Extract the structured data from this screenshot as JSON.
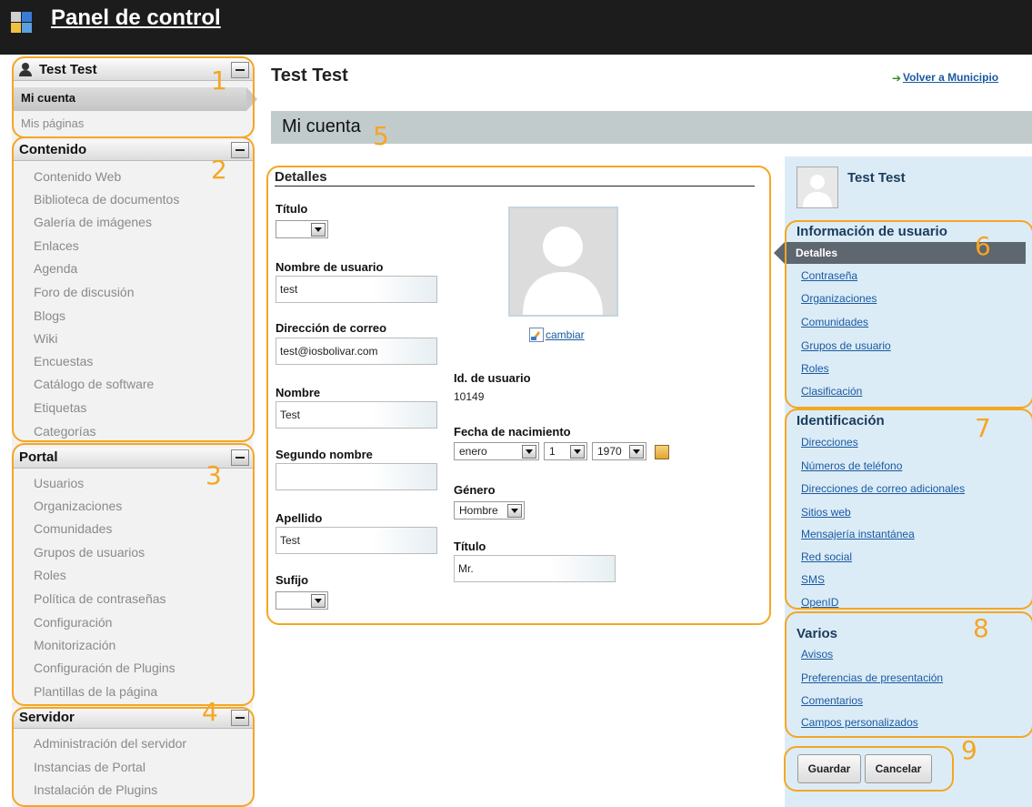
{
  "header": {
    "title": "Panel de control"
  },
  "sidebar": {
    "user": {
      "name": "Test Test",
      "items": [
        "Mi cuenta",
        "Mis páginas"
      ]
    },
    "contenido": {
      "title": "Contenido",
      "items": [
        "Contenido Web",
        "Biblioteca de documentos",
        "Galería de imágenes",
        "Enlaces",
        "Agenda",
        "Foro de discusión",
        "Blogs",
        "Wiki",
        "Encuestas",
        "Catálogo de software",
        "Etiquetas",
        "Categorías"
      ]
    },
    "portal": {
      "title": "Portal",
      "items": [
        "Usuarios",
        "Organizaciones",
        "Comunidades",
        "Grupos de usuarios",
        "Roles",
        "Política de contraseñas",
        "Configuración",
        "Monitorización",
        "Configuración de Plugins",
        "Plantillas de la página"
      ]
    },
    "servidor": {
      "title": "Servidor",
      "items": [
        "Administración del servidor",
        "Instancias de Portal",
        "Instalación de Plugins"
      ]
    }
  },
  "main": {
    "title": "Test Test",
    "back_link": "Volver a Municipio",
    "band_title": "Mi cuenta",
    "details_title": "Detalles"
  },
  "form": {
    "titulo_label": "Título",
    "titulo_value": "",
    "username_label": "Nombre de usuario",
    "username_value": "test",
    "email_label": "Dirección de correo",
    "email_value": "test@iosbolivar.com",
    "nombre_label": "Nombre",
    "nombre_value": "Test",
    "segundo_label": "Segundo nombre",
    "segundo_value": "",
    "apellido_label": "Apellido",
    "apellido_value": "Test",
    "sufijo_label": "Sufijo",
    "sufijo_value": "",
    "cambiar": "cambiar",
    "id_label": "Id. de usuario",
    "id_value": "10149",
    "birth_label": "Fecha de nacimiento",
    "birth_month": "enero",
    "birth_day": "1",
    "birth_year": "1970",
    "gender_label": "Género",
    "gender_value": "Hombre",
    "title2_label": "Título",
    "title2_value": "Mr."
  },
  "rpanel": {
    "name": "Test Test",
    "user_info_title": "Información de usuario",
    "user_info_items": [
      "Detalles",
      "Contraseña",
      "Organizaciones",
      "Comunidades",
      "Grupos de usuario",
      "Roles",
      "Clasificación"
    ],
    "ident_title": "Identificación",
    "ident_items": [
      "Direcciones",
      "Números de teléfono",
      "Direcciones de correo adicionales",
      "Sitios web",
      "Mensajería instantánea",
      "Red social",
      "SMS",
      "OpenID"
    ],
    "varios_title": "Varios",
    "varios_items": [
      "Avisos",
      "Preferencias de presentación",
      "Comentarios",
      "Campos personalizados"
    ],
    "save": "Guardar",
    "cancel": "Cancelar"
  },
  "annotations": [
    "1",
    "2",
    "3",
    "4",
    "5",
    "6",
    "7",
    "8",
    "9"
  ],
  "colors": {
    "annotation": "#f5a623",
    "link": "#1a5aa0",
    "header_bg": "#1c1c1c",
    "panel_bg": "#dcecf7"
  }
}
